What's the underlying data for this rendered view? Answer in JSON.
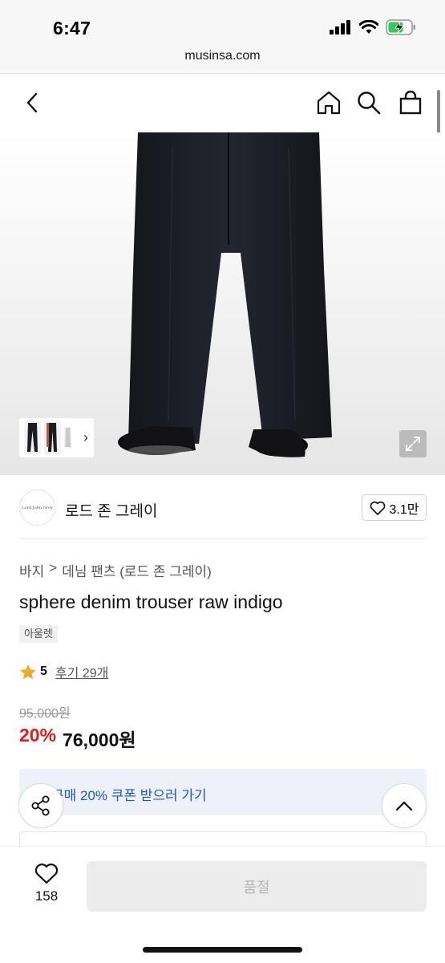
{
  "status_bar": {
    "time": "6:47"
  },
  "browser": {
    "url": "musinsa.com"
  },
  "nav": {
    "back_icon": "chevron-left-icon",
    "home_icon": "home-icon",
    "search_icon": "search-icon",
    "cart_icon": "shopping-bag-icon"
  },
  "brand": {
    "logo_text": "Lord John Grey",
    "name": "로드 존 그레이",
    "likes": "3.1만"
  },
  "breadcrumb": {
    "category": "바지",
    "separator": ">",
    "subcategory": "데님 팬츠 (로드 존 그레이)"
  },
  "product": {
    "title": "sphere denim trouser raw indigo",
    "badge": "아울렛",
    "rating": "5",
    "reviews": "후기 29개",
    "original_price": "95,000원",
    "discount": "20%",
    "sale_price": "76,000원"
  },
  "coupon": {
    "text": "구매 20% 쿠폰 받으러 가기"
  },
  "bottom_bar": {
    "wish_count": "158",
    "purchase_label": "품절"
  },
  "colors": {
    "accent_red": "#e01e1e",
    "coupon_blue": "#1a56d6",
    "star_orange": "#f5a623",
    "battery_green": "#34c759"
  }
}
